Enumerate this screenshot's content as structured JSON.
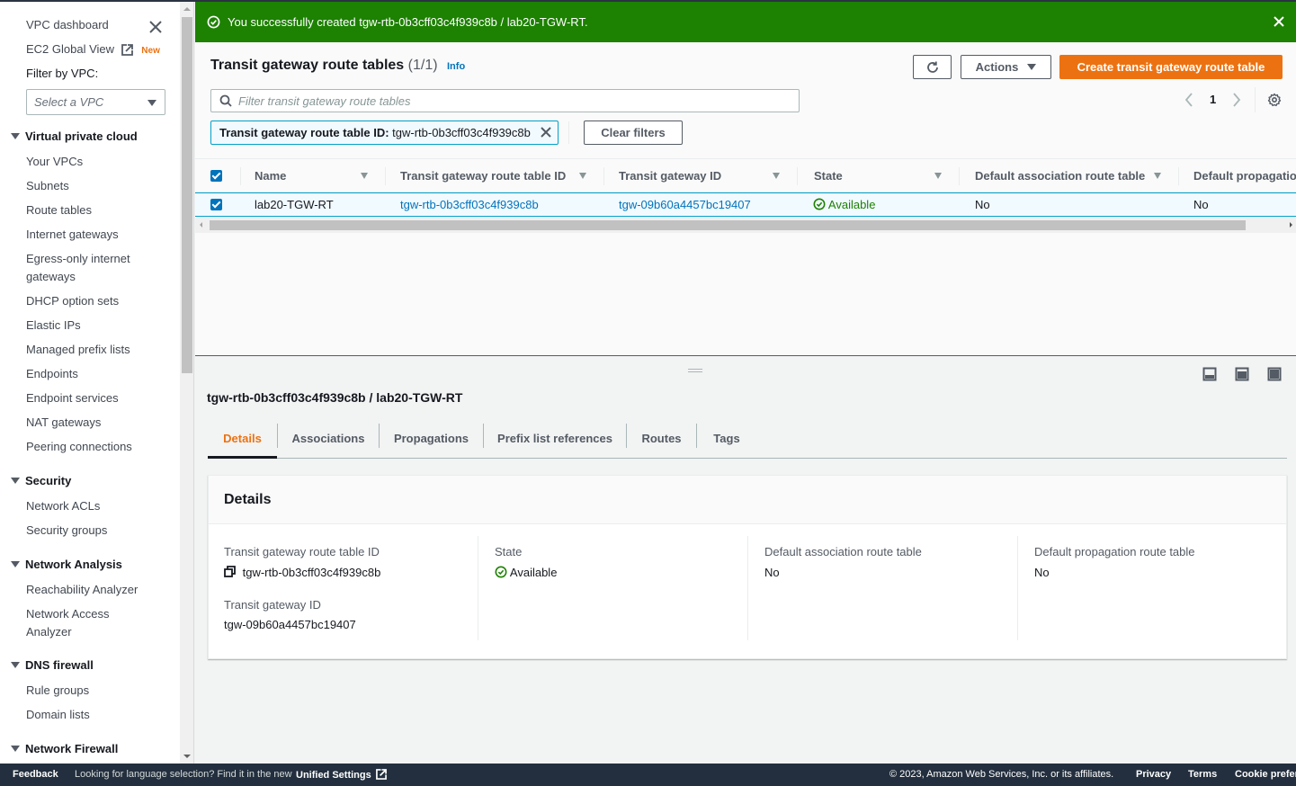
{
  "sidebar": {
    "top_links": {
      "vpc_dashboard": "VPC dashboard",
      "ec2_global_view": "EC2 Global View",
      "new_badge": "New"
    },
    "filter_label": "Filter by VPC:",
    "vpc_select_placeholder": "Select a VPC",
    "sections": [
      {
        "title": "Virtual private cloud",
        "items": [
          "Your VPCs",
          "Subnets",
          "Route tables",
          "Internet gateways",
          "Egress-only internet gateways",
          "DHCP option sets",
          "Elastic IPs",
          "Managed prefix lists",
          "Endpoints",
          "Endpoint services",
          "NAT gateways",
          "Peering connections"
        ]
      },
      {
        "title": "Security",
        "items": [
          "Network ACLs",
          "Security groups"
        ]
      },
      {
        "title": "Network Analysis",
        "items": [
          "Reachability Analyzer",
          "Network Access Analyzer"
        ]
      },
      {
        "title": "DNS firewall",
        "items": [
          "Rule groups",
          "Domain lists"
        ]
      },
      {
        "title": "Network Firewall",
        "items": []
      }
    ]
  },
  "flash": {
    "message": "You successfully created tgw-rtb-0b3cff03c4f939c8b / lab20-TGW-RT.",
    "color": "#1d8102"
  },
  "list": {
    "title": "Transit gateway route tables",
    "count": "(1/1)",
    "info_link": "Info",
    "actions_label": "Actions",
    "create_label": "Create transit gateway route table",
    "filter_placeholder": "Filter transit gateway route tables",
    "filter_value": "",
    "page_number": "1",
    "token_key": "Transit gateway route table ID:",
    "token_value": "tgw-rtb-0b3cff03c4f939c8b",
    "clear_filters_label": "Clear filters",
    "columns": [
      "Name",
      "Transit gateway route table ID",
      "Transit gateway ID",
      "State",
      "Default association route table",
      "Default propagatio"
    ],
    "rows": [
      {
        "selected": true,
        "name": "lab20-TGW-RT",
        "route_table_id": "tgw-rtb-0b3cff03c4f939c8b",
        "tgw_id": "tgw-09b60a4457bc19407",
        "state": "Available",
        "default_association": "No",
        "default_propagation": "No"
      }
    ]
  },
  "split_panel": {
    "title": "tgw-rtb-0b3cff03c4f939c8b / lab20-TGW-RT",
    "tabs": [
      "Details",
      "Associations",
      "Propagations",
      "Prefix list references",
      "Routes",
      "Tags"
    ],
    "active_tab": "Details",
    "details": {
      "heading": "Details",
      "route_table_id_label": "Transit gateway route table ID",
      "route_table_id_value": "tgw-rtb-0b3cff03c4f939c8b",
      "tgw_id_label": "Transit gateway ID",
      "tgw_id_value": "tgw-09b60a4457bc19407",
      "state_label": "State",
      "state_value": "Available",
      "default_association_label": "Default association route table",
      "default_association_value": "No",
      "default_propagation_label": "Default propagation route table",
      "default_propagation_value": "No"
    }
  },
  "footer": {
    "feedback": "Feedback",
    "language_note": "Looking for language selection? Find it in the new",
    "unified_settings": "Unified Settings",
    "copyright": "© 2023, Amazon Web Services, Inc. or its affiliates.",
    "privacy": "Privacy",
    "terms": "Terms",
    "cookie": "Cookie prefere"
  },
  "colors": {
    "accent": "#ec7211",
    "link": "#0073bb",
    "success": "#1d8102",
    "selected_row_border": "#00a1c9"
  }
}
